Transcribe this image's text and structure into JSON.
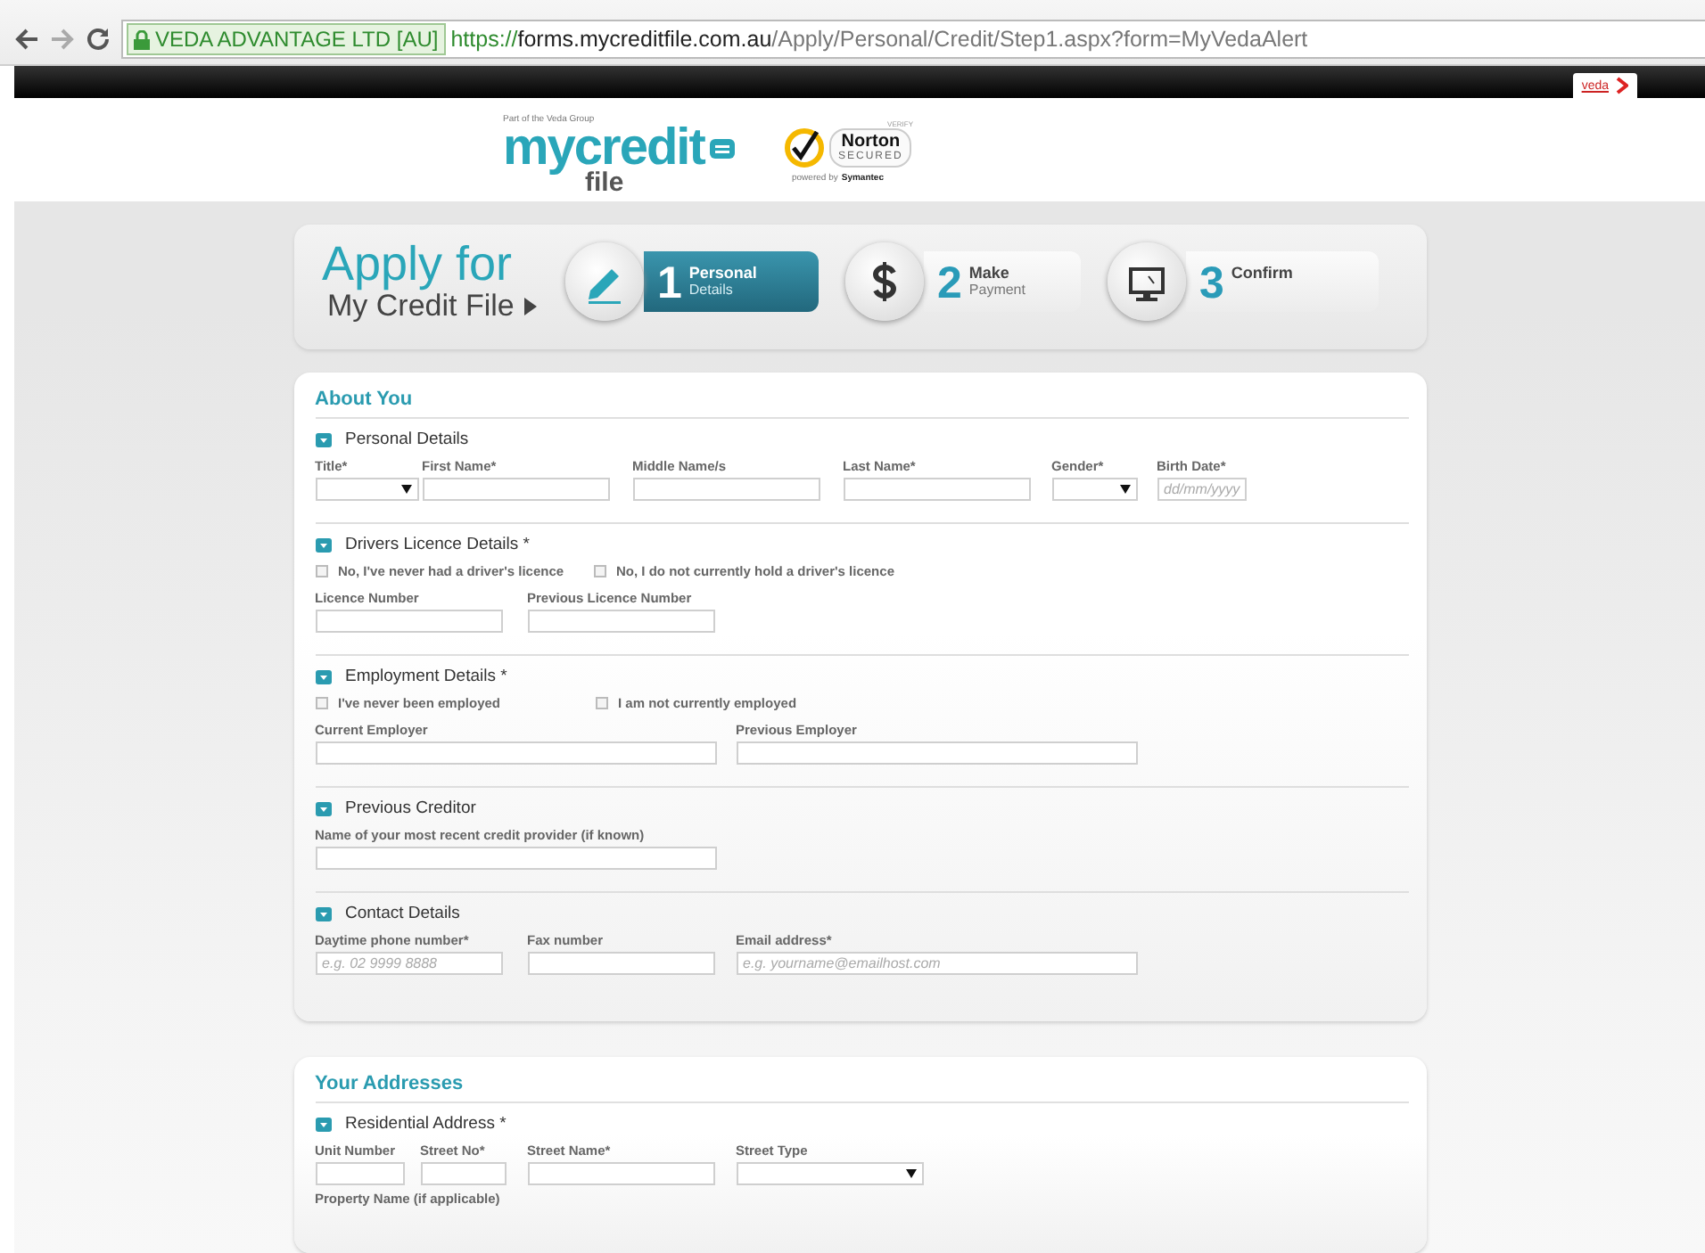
{
  "browser": {
    "identity": "VEDA ADVANTAGE LTD [AU]",
    "url_scheme": "https://",
    "url_host": "forms.mycreditfile.com.au",
    "url_path": "/Apply/Personal/Credit/Step1.aspx?form=MyVedaAlert"
  },
  "top_bar": {
    "brand_tab": "veda"
  },
  "header": {
    "tagline": "Part of the Veda Group",
    "logo_top": "mycredit",
    "logo_bottom": "file",
    "seal": {
      "verify": "VERIFY",
      "name": "Norton",
      "status": "SECURED",
      "powered_by": "powered by",
      "company": "Symantec"
    }
  },
  "steps_banner": {
    "title": "Apply for",
    "subtitle": "My Credit File",
    "steps": [
      {
        "number": "1",
        "title": "Personal",
        "subtitle": "Details",
        "selected": true
      },
      {
        "number": "2",
        "title": "Make",
        "subtitle": "Payment",
        "selected": false
      },
      {
        "number": "3",
        "title": "Confirm",
        "selected": false
      }
    ]
  },
  "cards": [
    {
      "title": "About You",
      "sections": [
        {
          "heading": "Personal Details",
          "rows": [
            {
              "kind": "fields",
              "fields": [
                {
                  "label": "Title*",
                  "kind": "select"
                },
                {
                  "label": "First Name*",
                  "kind": "text"
                },
                {
                  "label": "Middle Name/s",
                  "kind": "text"
                },
                {
                  "label": "Last Name*",
                  "kind": "text"
                },
                {
                  "label": "Gender*",
                  "kind": "select"
                },
                {
                  "label": "Birth Date*",
                  "kind": "text",
                  "placeholder": "dd/mm/yyyy"
                }
              ]
            }
          ]
        },
        {
          "heading": "Drivers Licence Details *",
          "rows": [
            {
              "kind": "checks",
              "items": [
                {
                  "label": "No, I've never had a driver's licence",
                  "checked": false
                },
                {
                  "label": "No, I do not currently hold a driver's licence",
                  "checked": false
                }
              ]
            },
            {
              "kind": "fields",
              "fields": [
                {
                  "label": "Licence Number",
                  "kind": "text"
                },
                {
                  "label": "Previous Licence Number",
                  "kind": "text"
                }
              ]
            }
          ]
        },
        {
          "heading": "Employment Details *",
          "rows": [
            {
              "kind": "checks",
              "items": [
                {
                  "label": "I've never been employed",
                  "checked": false
                },
                {
                  "label": "I am not currently employed",
                  "checked": false
                }
              ]
            },
            {
              "kind": "fields",
              "fields": [
                {
                  "label": "Current Employer",
                  "kind": "text"
                },
                {
                  "label": "Previous Employer",
                  "kind": "text"
                }
              ]
            }
          ]
        },
        {
          "heading": "Previous Creditor",
          "rows": [
            {
              "kind": "fields",
              "fields": [
                {
                  "label": "Name of your most recent credit provider (if known)",
                  "kind": "text"
                }
              ]
            }
          ]
        },
        {
          "heading": "Contact Details",
          "rows": [
            {
              "kind": "fields",
              "fields": [
                {
                  "label": "Daytime phone number*",
                  "kind": "text",
                  "placeholder": "e.g. 02 9999 8888"
                },
                {
                  "label": "Fax number",
                  "kind": "text"
                },
                {
                  "label": "Email address*",
                  "kind": "text",
                  "placeholder": "e.g. yourname@emailhost.com"
                }
              ]
            }
          ]
        }
      ]
    },
    {
      "title": "Your Addresses",
      "sections": [
        {
          "heading": "Residential Address *",
          "rows": [
            {
              "kind": "fields",
              "fields": [
                {
                  "label": "Unit Number",
                  "kind": "text"
                },
                {
                  "label": "Street No*",
                  "kind": "text"
                },
                {
                  "label": "Street Name*",
                  "kind": "text"
                },
                {
                  "label": "Street Type",
                  "kind": "select"
                }
              ]
            },
            {
              "kind": "label",
              "text": "Property Name (if applicable)"
            }
          ]
        }
      ]
    }
  ]
}
